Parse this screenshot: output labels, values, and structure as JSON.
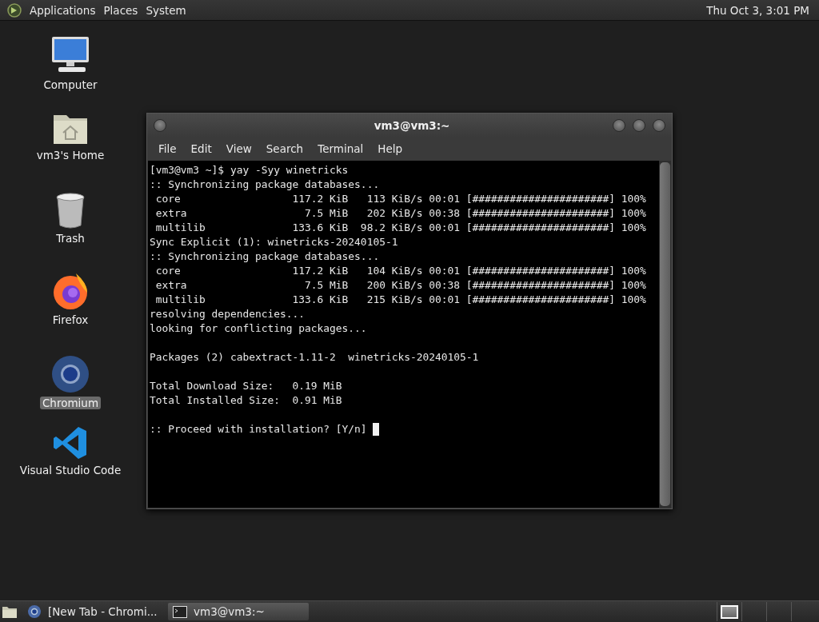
{
  "top_panel": {
    "menus": [
      "Applications",
      "Places",
      "System"
    ],
    "clock": "Thu Oct  3,  3:01 PM"
  },
  "desktop_icons": [
    {
      "kind": "computer",
      "label": "Computer",
      "selected": false
    },
    {
      "kind": "home",
      "label": "vm3's Home",
      "selected": false
    },
    {
      "kind": "trash",
      "label": "Trash",
      "selected": false
    },
    {
      "kind": "firefox",
      "label": "Firefox",
      "selected": false
    },
    {
      "kind": "chromium",
      "label": "Chromium",
      "selected": true
    },
    {
      "kind": "vscode",
      "label": "Visual Studio Code",
      "selected": false
    }
  ],
  "terminal": {
    "title": "vm3@vm3:~",
    "menus": [
      "File",
      "Edit",
      "View",
      "Search",
      "Terminal",
      "Help"
    ],
    "blocks": [
      [
        "[vm3@vm3 ~]$ yay -Syy winetricks",
        ":: Synchronizing package databases...",
        " core                  117.2 KiB   113 KiB/s 00:01 [######################] 100%",
        " extra                   7.5 MiB   202 KiB/s 00:38 [######################] 100%",
        " multilib              133.6 KiB  98.2 KiB/s 00:01 [######################] 100%",
        "Sync Explicit (1): winetricks-20240105-1",
        ":: Synchronizing package databases...",
        " core                  117.2 KiB   104 KiB/s 00:01 [######################] 100%",
        " extra                   7.5 MiB   200 KiB/s 00:38 [######################] 100%",
        " multilib              133.6 KiB   215 KiB/s 00:01 [######################] 100%",
        "resolving dependencies...",
        "looking for conflicting packages..."
      ],
      [
        "Packages (2) cabextract-1.11-2  winetricks-20240105-1"
      ],
      [
        "Total Download Size:   0.19 MiB",
        "Total Installed Size:  0.91 MiB"
      ],
      [
        ":: Proceed with installation? [Y/n] "
      ]
    ],
    "cursor": true
  },
  "taskbar": [
    {
      "kind": "chromium",
      "label": "[New Tab - Chromi...",
      "selected": false
    },
    {
      "kind": "terminal",
      "label": "vm3@vm3:~",
      "selected": true
    }
  ],
  "workspaces": [
    {
      "selected": true
    },
    {
      "selected": false
    },
    {
      "selected": false
    },
    {
      "selected": false
    }
  ]
}
